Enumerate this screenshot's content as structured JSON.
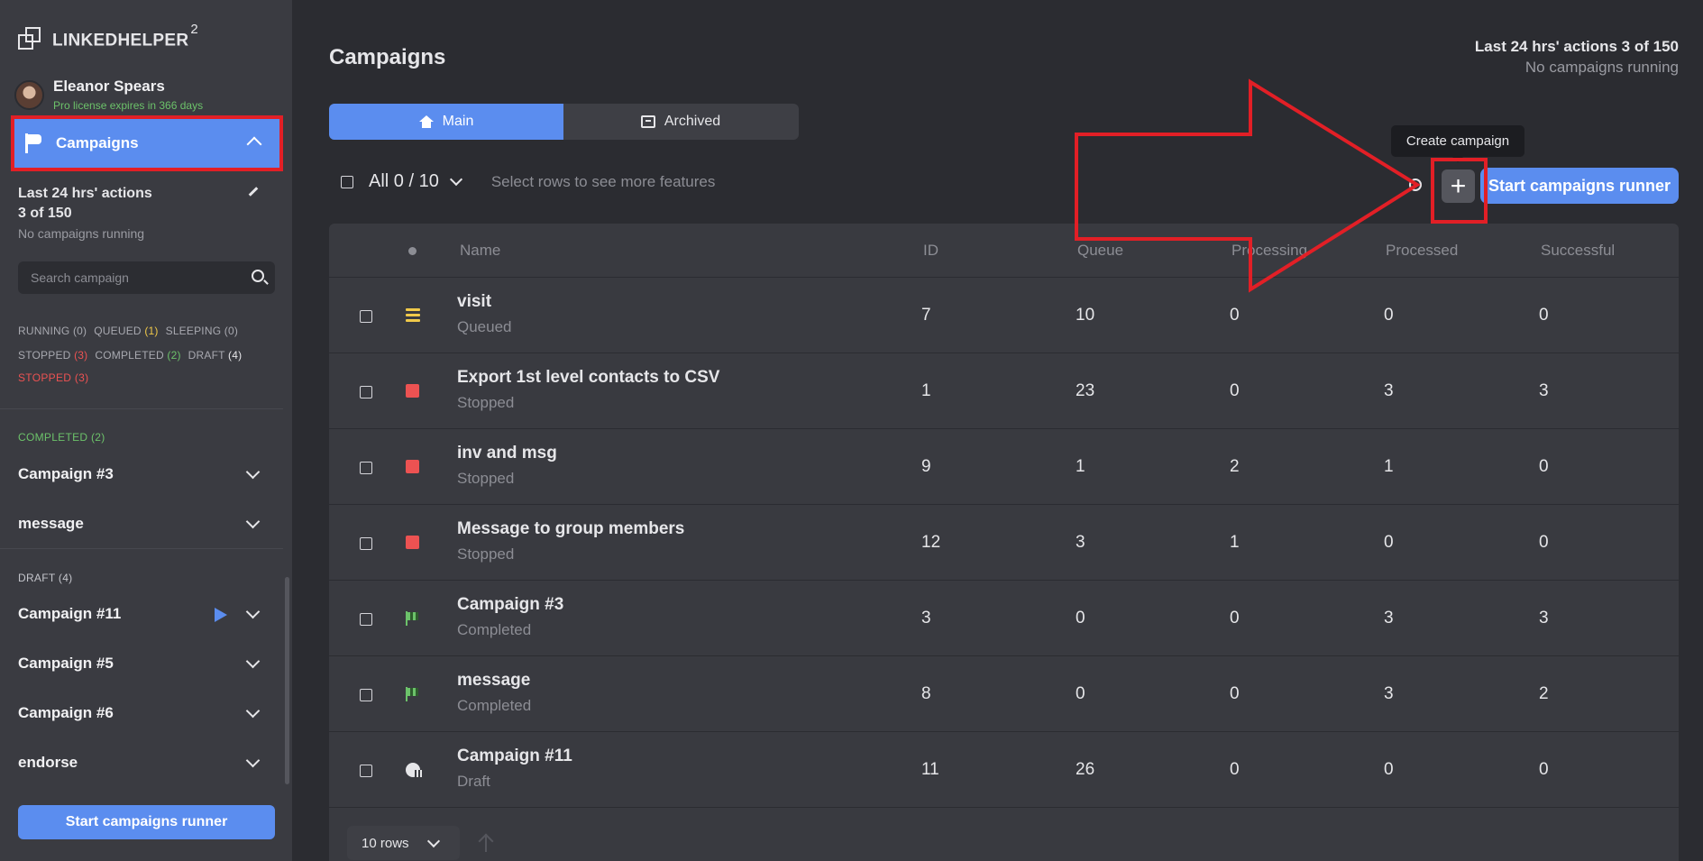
{
  "app": {
    "name": "LINKEDHELPER",
    "version_sup": "2"
  },
  "user": {
    "name": "Eleanor Spears",
    "license": "Pro license expires in 366 days"
  },
  "nav": {
    "campaigns_label": "Campaigns"
  },
  "sidebar": {
    "actions_title": "Last 24 hrs' actions",
    "actions_count": "3 of 150",
    "running_status": "No campaigns running",
    "search_placeholder": "Search campaign",
    "stats_line1": [
      {
        "label": "RUNNING",
        "count": "(0)"
      },
      {
        "label": "QUEUED",
        "count": "(1)"
      },
      {
        "label": "SLEEPING",
        "count": "(0)"
      }
    ],
    "stats_line2": [
      {
        "label": "STOPPED",
        "count": "(3)"
      },
      {
        "label": "COMPLETED",
        "count": "(2)"
      },
      {
        "label": "DRAFT",
        "count": "(4)"
      }
    ],
    "stopped_section": "STOPPED (3)",
    "completed_section": "COMPLETED (2)",
    "completed_items": [
      "Campaign #3",
      "message"
    ],
    "draft_section": "DRAFT (4)",
    "draft_items": [
      "Campaign #11",
      "Campaign #5",
      "Campaign #6",
      "endorse"
    ],
    "runner_button": "Start campaigns runner"
  },
  "header": {
    "title": "Campaigns",
    "stats_line1": "Last 24 hrs' actions 3 of 150",
    "stats_line2": "No campaigns running"
  },
  "tabs": [
    {
      "label": "Main",
      "icon": "home-icon",
      "active": true
    },
    {
      "label": "Archived",
      "icon": "archive-icon",
      "active": false
    }
  ],
  "toolbar": {
    "selection": "All 0 / 10",
    "hint": "Select rows to see more features",
    "tooltip": "Create campaign",
    "create_symbol": "+",
    "runner_button": "Start campaigns runner"
  },
  "table": {
    "columns": [
      "Name",
      "ID",
      "Queue",
      "Processing",
      "Processed",
      "Successful"
    ],
    "rows": [
      {
        "name": "visit",
        "status": "Queued",
        "id": "7",
        "queue": "10",
        "processing": "0",
        "processed": "0",
        "successful": "0"
      },
      {
        "name": "Export 1st level contacts to CSV",
        "status": "Stopped",
        "id": "1",
        "queue": "23",
        "processing": "0",
        "processed": "3",
        "successful": "3"
      },
      {
        "name": "inv and msg",
        "status": "Stopped",
        "id": "9",
        "queue": "1",
        "processing": "2",
        "processed": "1",
        "successful": "0"
      },
      {
        "name": "Message to group members",
        "status": "Stopped",
        "id": "12",
        "queue": "3",
        "processing": "1",
        "processed": "0",
        "successful": "0"
      },
      {
        "name": "Campaign #3",
        "status": "Completed",
        "id": "3",
        "queue": "0",
        "processing": "0",
        "processed": "3",
        "successful": "3"
      },
      {
        "name": "message",
        "status": "Completed",
        "id": "8",
        "queue": "0",
        "processing": "0",
        "processed": "3",
        "successful": "2"
      },
      {
        "name": "Campaign #11",
        "status": "Draft",
        "id": "11",
        "queue": "26",
        "processing": "0",
        "processed": "0",
        "successful": "0"
      }
    ]
  },
  "pagination": {
    "rows_label": "10 rows"
  },
  "colors": {
    "accent": "#5b8def",
    "annotation": "#e21f26",
    "queued": "#f0c94a",
    "stopped": "#ec5252",
    "completed": "#6cc26a"
  }
}
